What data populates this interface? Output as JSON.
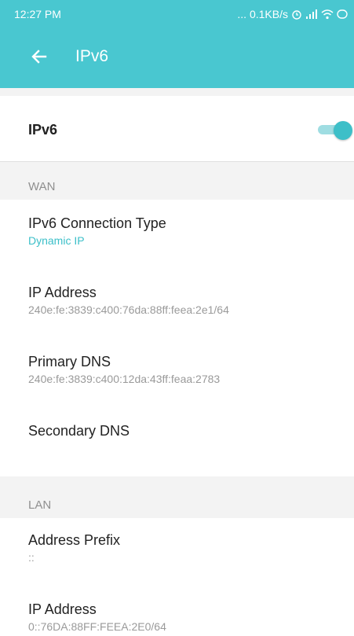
{
  "status_bar": {
    "time": "12:27 PM",
    "right_text": "... 0.1KB/s",
    "icons": [
      "alarm-icon",
      "signal-icon",
      "wifi-icon",
      "battery-icon"
    ]
  },
  "app_bar": {
    "title": "IPv6",
    "back_icon": "back-arrow-icon"
  },
  "ipv6_switch": {
    "label": "IPv6",
    "enabled": true
  },
  "wan": {
    "header": "WAN",
    "items": [
      {
        "label": "IPv6 Connection Type",
        "value": "Dynamic IP"
      },
      {
        "label": "IP Address",
        "value": "240e:fe:3839:c400:76da:88ff:feea:2e1/64"
      },
      {
        "label": "Primary DNS",
        "value": "240e:fe:3839:c400:12da:43ff:feaa:2783"
      },
      {
        "label": "Secondary DNS",
        "value": ""
      }
    ]
  },
  "lan": {
    "header": "LAN",
    "items": [
      {
        "label": "Address Prefix",
        "value": "::"
      },
      {
        "label": "IP Address",
        "value": "0::76DA:88FF:FEEA:2E0/64"
      }
    ]
  },
  "colors": {
    "accent": "#49c7d0",
    "toggle_thumb": "#3dbfc8",
    "toggle_track": "#9fdde2",
    "section_bg": "#f3f3f3"
  }
}
